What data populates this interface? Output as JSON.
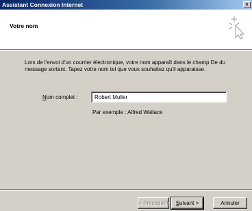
{
  "window": {
    "title": "Assistant Connexion Internet",
    "close_glyph": "×"
  },
  "header": {
    "title": "Votre nom",
    "icon": "wizard-sparkle-icon"
  },
  "description": "Lors de l'envoi d'un courrier électronique, votre nom apparaît dans le champ De du message sortant. Tapez votre nom tel que vous souhaitez qu'il apparaisse.",
  "form": {
    "label": "Nom complet :",
    "value": "Robert Muller",
    "example": "Par exemple : Alfred Wallace"
  },
  "buttons": {
    "back": "< Précédent",
    "next": "Suivant >",
    "cancel": "Annuler"
  }
}
